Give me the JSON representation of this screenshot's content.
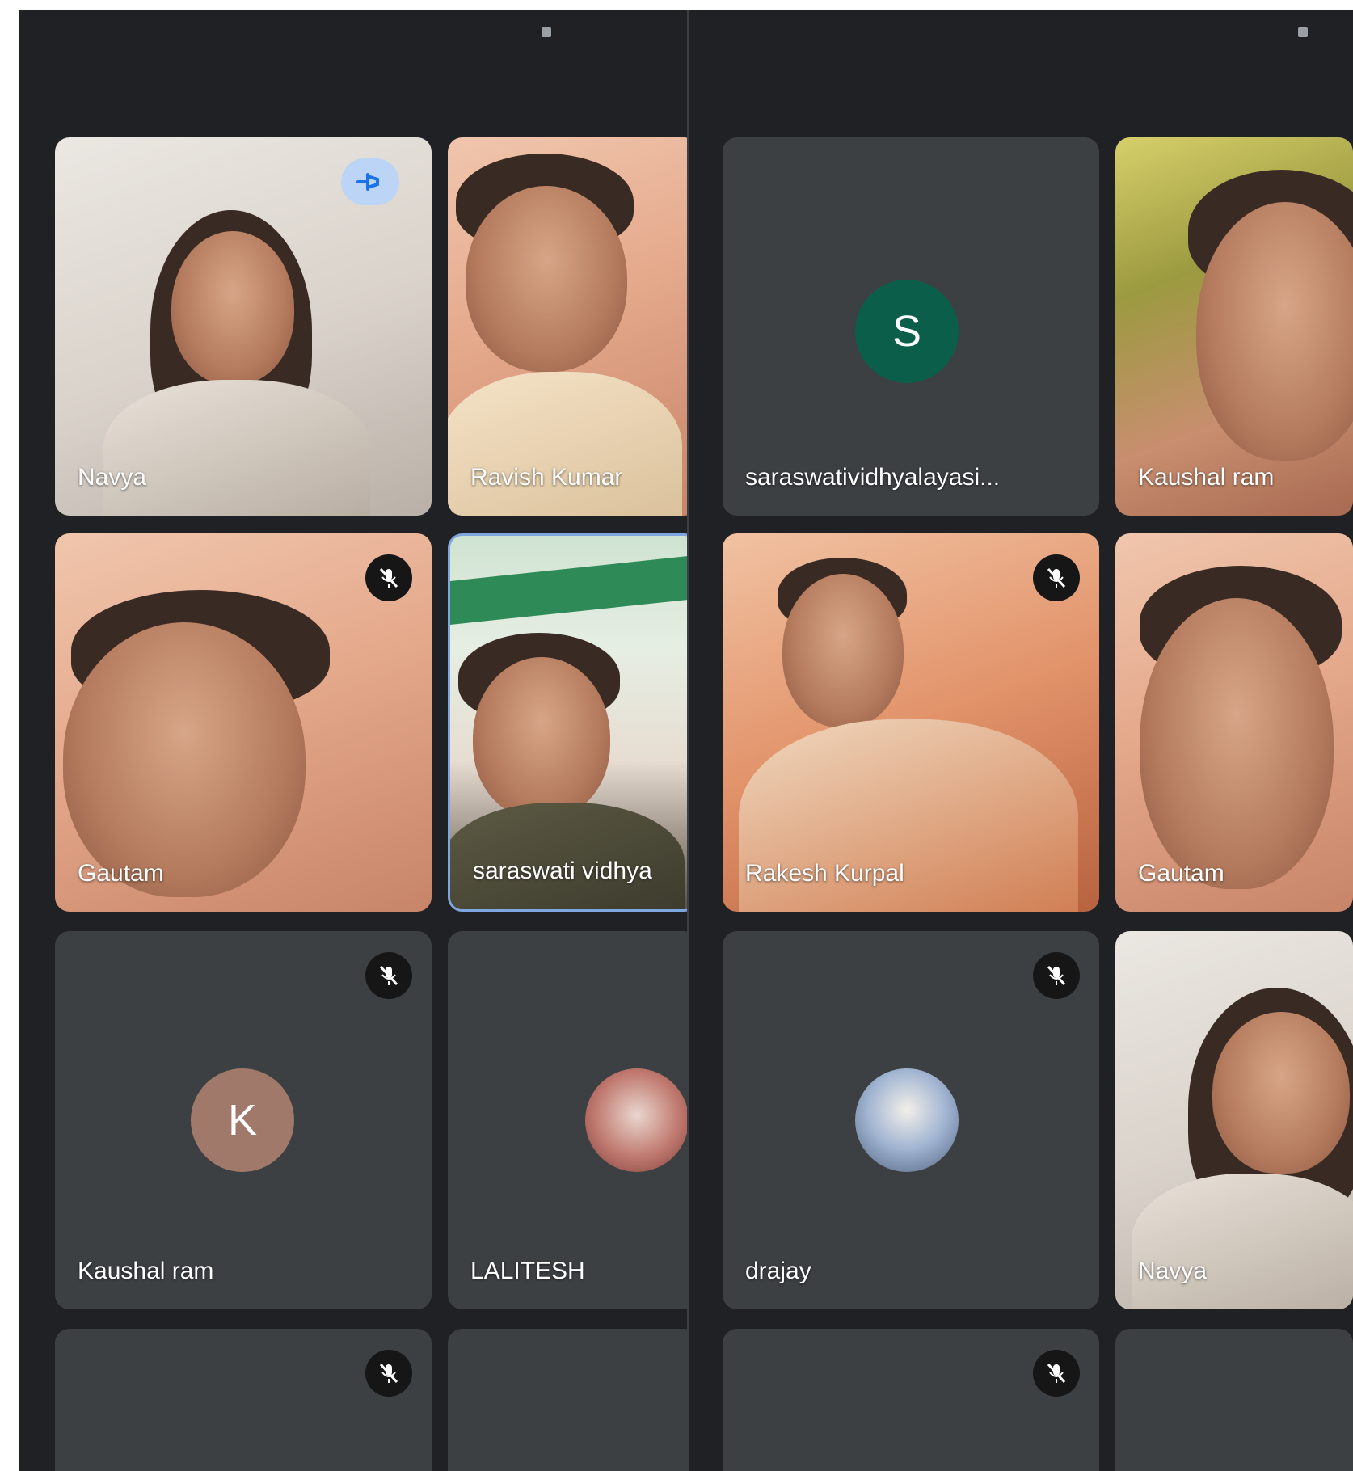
{
  "left_panel": {
    "tiles": [
      {
        "name": "Navya",
        "status": "pinned"
      },
      {
        "name": "Ravish Kumar",
        "status": "unmuted"
      },
      {
        "name": "Gautam",
        "status": "muted"
      },
      {
        "name": "saraswati vidhya",
        "status": "unmuted"
      },
      {
        "name": "Kaushal ram",
        "status": "muted",
        "avatar_letter": "K"
      },
      {
        "name": "LALITESH",
        "status": "unmuted"
      },
      {
        "name": "",
        "status": "muted"
      },
      {
        "name": "",
        "status": "unmuted"
      }
    ]
  },
  "right_panel": {
    "tiles": [
      {
        "name": "saraswatividhyalayasi...",
        "status": "unmuted",
        "avatar_letter": "S"
      },
      {
        "name": "Kaushal ram",
        "status": "unmuted"
      },
      {
        "name": "Rakesh Kurpal",
        "status": "muted"
      },
      {
        "name": "Gautam",
        "status": "unmuted"
      },
      {
        "name": "drajay",
        "status": "muted"
      },
      {
        "name": "Navya",
        "status": "unmuted"
      },
      {
        "name": "",
        "status": "muted"
      },
      {
        "name": "",
        "status": "unmuted"
      }
    ]
  },
  "colors": {
    "background": "#202124",
    "tile": "#3c4043",
    "avatar_k": "#a1796b",
    "avatar_s": "#0b5e4a",
    "pin_bg": "#bcd5f7",
    "pin_icon": "#1a73e8"
  }
}
